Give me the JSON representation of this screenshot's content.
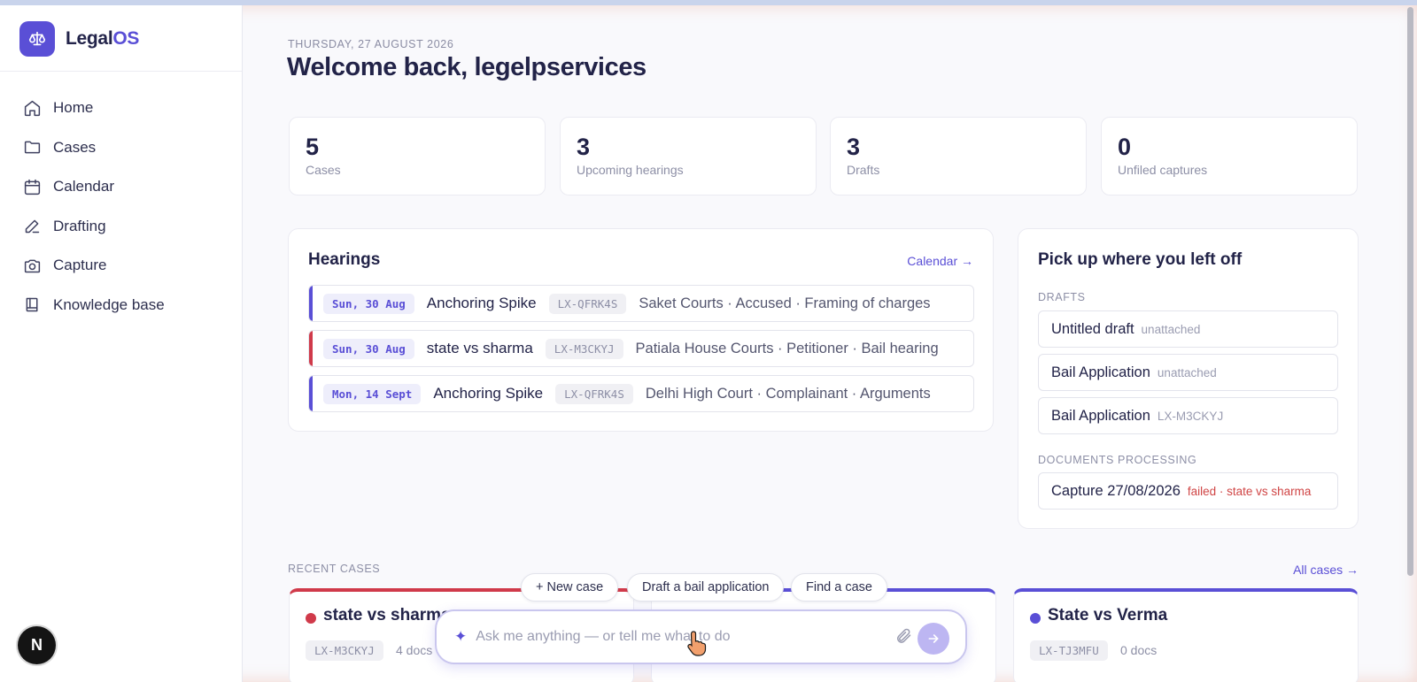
{
  "app": {
    "name_part1": "Legal",
    "name_part2": "OS"
  },
  "sidebar": {
    "items": [
      {
        "label": "Home",
        "icon": "home-icon"
      },
      {
        "label": "Cases",
        "icon": "folder-icon"
      },
      {
        "label": "Calendar",
        "icon": "calendar-icon"
      },
      {
        "label": "Drafting",
        "icon": "pen-icon"
      },
      {
        "label": "Capture",
        "icon": "camera-icon"
      },
      {
        "label": "Knowledge base",
        "icon": "book-icon"
      }
    ],
    "badge": "N"
  },
  "header": {
    "date": "THURSDAY, 27 AUGUST 2026",
    "welcome": "Welcome back, legelpservices"
  },
  "stats": [
    {
      "value": "5",
      "label": "Cases"
    },
    {
      "value": "3",
      "label": "Upcoming hearings"
    },
    {
      "value": "3",
      "label": "Drafts"
    },
    {
      "value": "0",
      "label": "Unfiled captures"
    }
  ],
  "hearings": {
    "title": "Hearings",
    "link": "Calendar →",
    "rows": [
      {
        "date": "Sun, 30 Aug",
        "name": "Anchoring Spike",
        "code": "LX-QFRK4S",
        "desc": "Saket Courts · Accused · Framing of charges",
        "color": "#5a4fd6"
      },
      {
        "date": "Sun, 30 Aug",
        "name": "state vs sharma",
        "code": "LX-M3CKYJ",
        "desc": "Patiala House Courts · Petitioner · Bail hearing",
        "color": "#d03a4a"
      },
      {
        "date": "Mon, 14 Sept",
        "name": "Anchoring Spike",
        "code": "LX-QFRK4S",
        "desc": "Delhi High Court · Complainant · Arguments",
        "color": "#5a4fd6"
      }
    ]
  },
  "pickup": {
    "title": "Pick up where you left off",
    "drafts_label": "DRAFTS",
    "drafts": [
      {
        "title": "Untitled draft",
        "sub": "unattached"
      },
      {
        "title": "Bail Application",
        "sub": "unattached"
      },
      {
        "title": "Bail Application",
        "sub": "LX-M3CKYJ"
      }
    ],
    "processing_label": "DOCUMENTS PROCESSING",
    "processing": [
      {
        "title": "Capture 27/08/2026",
        "sub": "failed · state vs sharma"
      }
    ]
  },
  "recent": {
    "label": "RECENT CASES",
    "link": "All cases →",
    "cases": [
      {
        "title": "state vs sharma",
        "code": "LX-M3CKYJ",
        "docs": "4 docs",
        "color": "#d03a4a"
      },
      {
        "title": "State vs Verma",
        "code": "LX-TJ3MFU",
        "docs": "0 docs",
        "color": "#5a4fd6"
      }
    ],
    "middle_card_color": "#5a4fd6"
  },
  "assistant": {
    "chips": [
      "+ New case",
      "Draft a bail application",
      "Find a case"
    ],
    "placeholder": "Ask me anything — or tell me what to do"
  }
}
